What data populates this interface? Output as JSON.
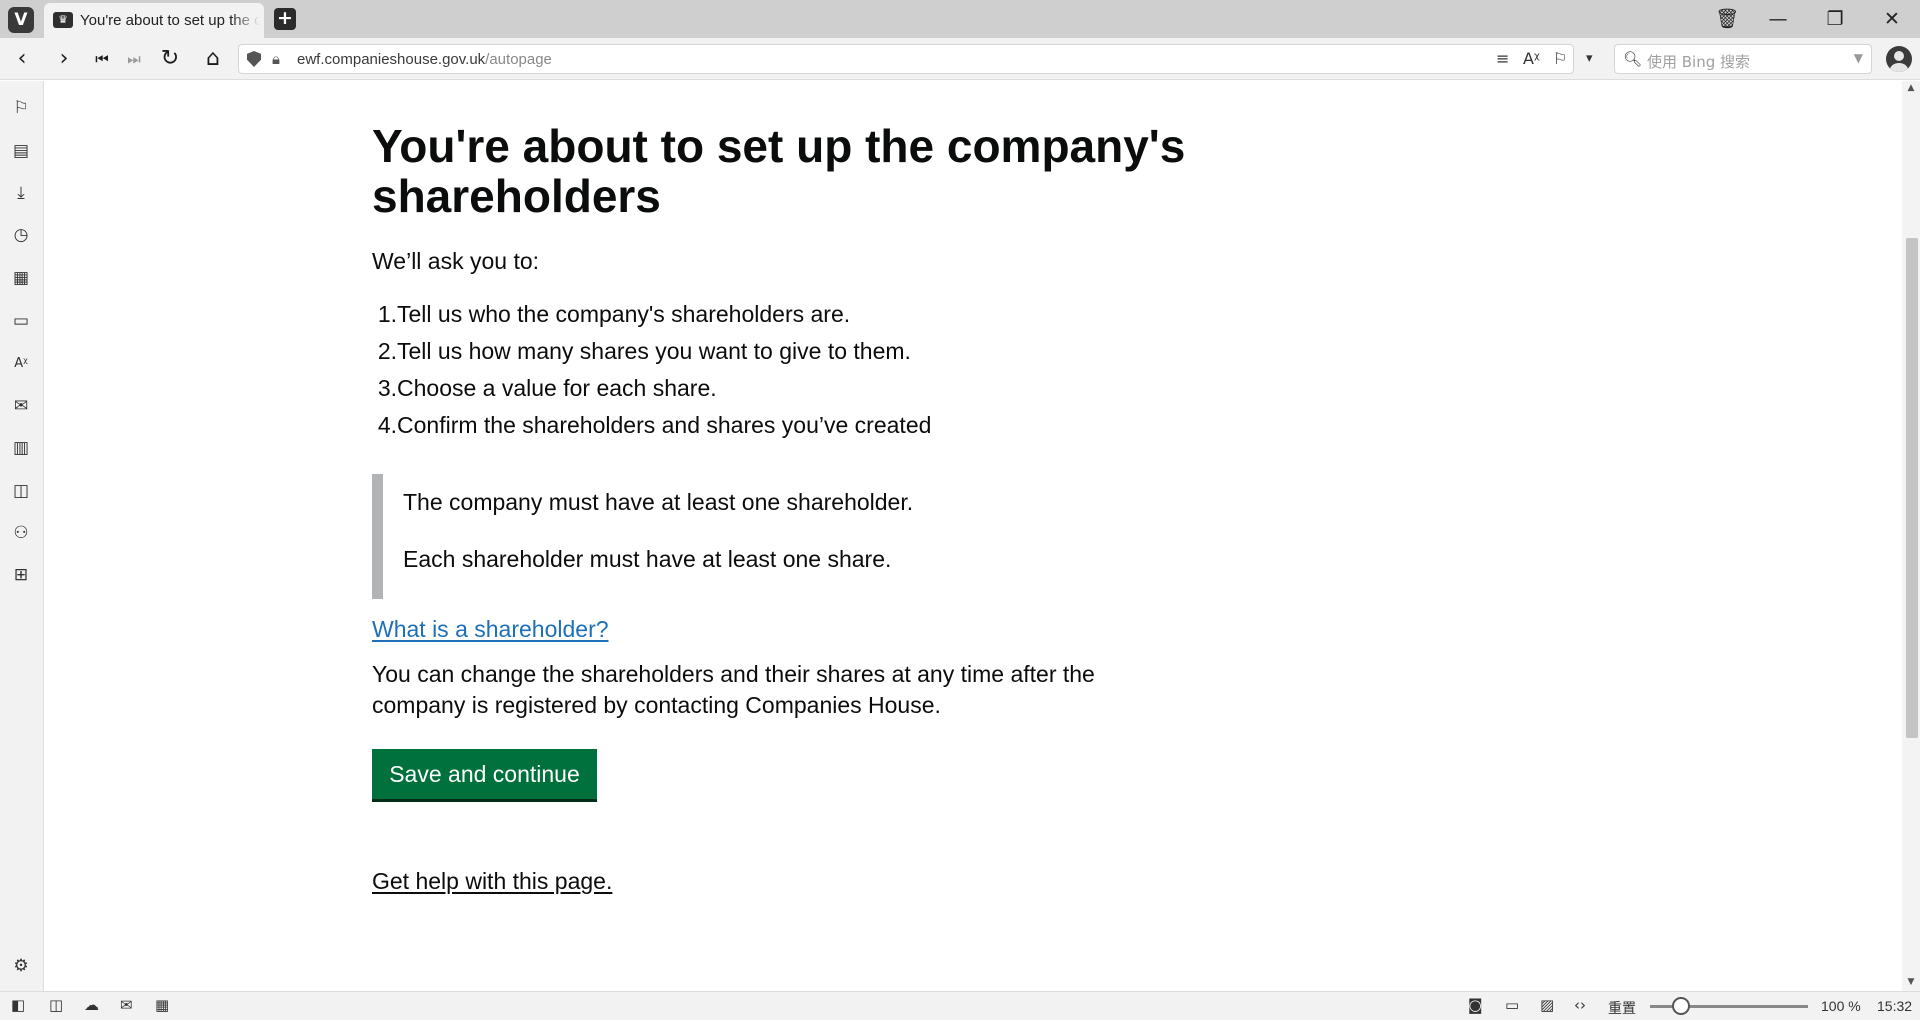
{
  "browser": {
    "tab": {
      "title": "You're about to set up the company's shareholders",
      "favicon": "crown-icon"
    },
    "new_tab_icon": "+",
    "window_controls": {
      "trash": "🗑",
      "minimize": "—",
      "maximize": "❐",
      "close": "✕"
    },
    "nav": {
      "back": "‹",
      "forward": "›",
      "rewind": "⏮",
      "fast_forward": "⏭",
      "reload": "↻",
      "home": "⌂"
    },
    "address": {
      "host": "ewf.companieshouse.gov.uk",
      "path": "/autopage"
    },
    "address_tools": {
      "reader": "≡",
      "translate": "Aᵡ",
      "bookmark": "🔖",
      "dropdown": "▾"
    },
    "search": {
      "placeholder": "使用 Bing 搜索"
    },
    "statusbar": {
      "reset_label": "重置",
      "zoom": "100 %",
      "clock": "15:32"
    }
  },
  "page": {
    "heading": "You're about to set up the company's shareholders",
    "lead": "We’ll ask you to:",
    "steps": [
      {
        "num": "1.",
        "text": "Tell us who the company's shareholders are."
      },
      {
        "num": "2.",
        "text": "Tell us how many shares you want to give to them."
      },
      {
        "num": "3.",
        "text": "Choose a value for each share."
      },
      {
        "num": "4.",
        "text": "Confirm the shareholders and shares you’ve created"
      }
    ],
    "inset": [
      "The company must have at least one shareholder.",
      "Each shareholder must have at least one share."
    ],
    "help_link": "What is a shareholder?",
    "note": "You can change the shareholders and their shares at any time after the company is registered by contacting Companies House.",
    "button": "Save and continue",
    "footer_link": "Get help with this page."
  },
  "colors": {
    "govuk_text": "#0b0c0c",
    "govuk_link": "#1d70b8",
    "govuk_button": "#00703c",
    "inset_border": "#b1b4b6",
    "browser_chrome": "#f2f2f2"
  }
}
